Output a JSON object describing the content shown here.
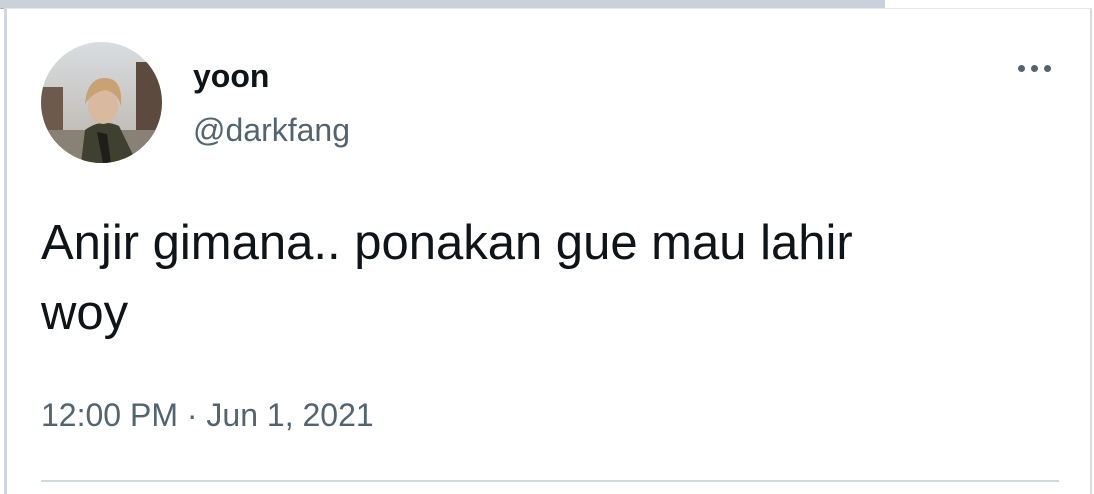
{
  "tweet": {
    "display_name": "yoon",
    "handle": "@darkfang",
    "text": "Anjir gimana.. ponakan gue mau lahir\nwoy",
    "timestamp": "12:00 PM · Jun 1, 2021"
  },
  "icons": {
    "more": "more-horizontal-icon",
    "avatar": "user-avatar-photo"
  },
  "colors": {
    "primary_text": "#0f1419",
    "secondary_text": "#536471",
    "divider": "#cfd9de"
  }
}
